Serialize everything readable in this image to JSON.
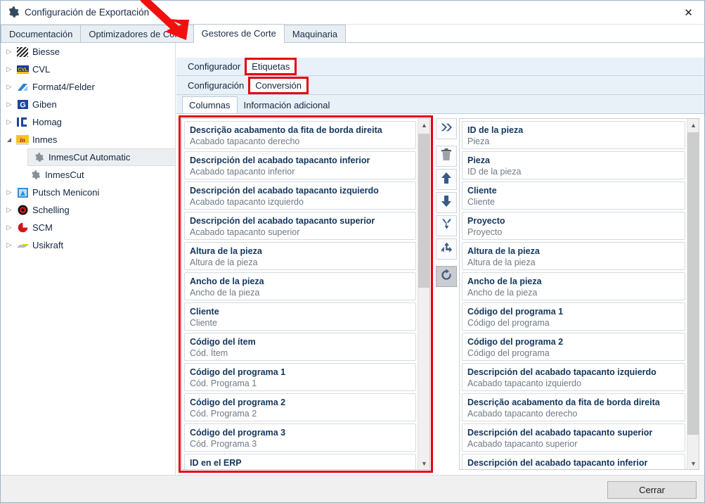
{
  "window": {
    "title": "Configuración de Exportación",
    "icon": "gear-icon",
    "close_label": "✕",
    "accent_red": "#e3000f",
    "title_color": "#12365e"
  },
  "top_tabs": [
    {
      "label": "Documentación",
      "active": false
    },
    {
      "label": "Optimizadores de Corte",
      "active": false
    },
    {
      "label": "Gestores de Corte",
      "active": true
    },
    {
      "label": "Maquinaria",
      "active": false
    }
  ],
  "sidebar": {
    "items": [
      {
        "label": "Biesse",
        "icon": "biesse-icon",
        "state": "collapsed",
        "level": 0
      },
      {
        "label": "CVL",
        "icon": "cvl-icon",
        "state": "collapsed",
        "level": 0
      },
      {
        "label": "Format4/Felder",
        "icon": "format4-icon",
        "state": "collapsed",
        "level": 0
      },
      {
        "label": "Giben",
        "icon": "giben-icon",
        "state": "collapsed",
        "level": 0
      },
      {
        "label": "Homag",
        "icon": "homag-icon",
        "state": "collapsed",
        "level": 0
      },
      {
        "label": "Inmes",
        "icon": "inmes-icon",
        "state": "expanded",
        "level": 0
      },
      {
        "label": "InmesCut Automatic",
        "icon": "gear-icon",
        "state": "selected",
        "level": 1
      },
      {
        "label": "InmesCut",
        "icon": "gear-icon",
        "state": "leaf",
        "level": 1
      },
      {
        "label": "Putsch Meniconi",
        "icon": "putsch-icon",
        "state": "collapsed",
        "level": 0
      },
      {
        "label": "Schelling",
        "icon": "schelling-icon",
        "state": "collapsed",
        "level": 0
      },
      {
        "label": "SCM",
        "icon": "scm-icon",
        "state": "collapsed",
        "level": 0
      },
      {
        "label": "Usikraft",
        "icon": "usikraft-icon",
        "state": "collapsed",
        "level": 0
      }
    ]
  },
  "level2_tabs": [
    {
      "label": "Configurador",
      "active": false,
      "highlighted": false
    },
    {
      "label": "Etiquetas",
      "active": true,
      "highlighted": true
    }
  ],
  "level3_tabs": [
    {
      "label": "Configuración",
      "active": false,
      "highlighted": false
    },
    {
      "label": "Conversión",
      "active": true,
      "highlighted": true
    }
  ],
  "level4_tabs": [
    {
      "label": "Columnas",
      "active": true
    },
    {
      "label": "Información adicional",
      "active": false
    }
  ],
  "available_list": {
    "highlighted": true,
    "scroll": {
      "thumb_top_pct": 4,
      "thumb_height_pct": 44
    },
    "items": [
      {
        "title": "Descrição acabamento da fita de borda direita",
        "sub": "Acabado tapacanto derecho"
      },
      {
        "title": "Descripción del acabado tapacanto inferior",
        "sub": "Acabado tapacanto inferior"
      },
      {
        "title": "Descripción del acabado tapacanto izquierdo",
        "sub": "Acabado tapacanto izquierdo"
      },
      {
        "title": "Descripción del acabado tapacanto superior",
        "sub": "Acabado tapacanto superior"
      },
      {
        "title": "Altura de la pieza",
        "sub": "Altura de la pieza"
      },
      {
        "title": "Ancho de la pieza",
        "sub": "Ancho de la pieza"
      },
      {
        "title": "Cliente",
        "sub": "Cliente"
      },
      {
        "title": "Código del ítem",
        "sub": "Cód. Ítem"
      },
      {
        "title": "Código del programa 1",
        "sub": "Cód. Programa 1"
      },
      {
        "title": "Código del programa 2",
        "sub": "Cód. Programa 2"
      },
      {
        "title": "Código del programa 3",
        "sub": "Cód. Programa 3"
      },
      {
        "title": "ID en el ERP",
        "sub": ""
      }
    ]
  },
  "selected_list": {
    "scroll": {
      "thumb_top_pct": 4,
      "thumb_height_pct": 86
    },
    "items": [
      {
        "title": "ID de la pieza",
        "sub": "Pieza"
      },
      {
        "title": "Pieza",
        "sub": "ID de la pieza"
      },
      {
        "title": "Cliente",
        "sub": "Cliente"
      },
      {
        "title": "Proyecto",
        "sub": "Proyecto"
      },
      {
        "title": "Altura de la pieza",
        "sub": "Altura de la pieza"
      },
      {
        "title": "Ancho de la pieza",
        "sub": "Ancho de la pieza"
      },
      {
        "title": "Código del programa 1",
        "sub": "Código del programa"
      },
      {
        "title": "Código del programa 2",
        "sub": "Código del programa"
      },
      {
        "title": "Descripción del acabado tapacanto izquierdo",
        "sub": "Acabado tapacanto izquierdo"
      },
      {
        "title": "Descrição acabamento da fita de borda direita",
        "sub": "Acabado tapacanto derecho"
      },
      {
        "title": "Descripción del acabado tapacanto superior",
        "sub": "Acabado tapacanto superior"
      },
      {
        "title": "Descripción del acabado tapacanto inferior",
        "sub": ""
      }
    ]
  },
  "transfer_buttons": [
    {
      "name": "move-all-right-button",
      "icon": "double-chevron-right-icon",
      "pressed": false
    },
    {
      "name": "delete-button",
      "icon": "trash-icon",
      "pressed": false
    },
    {
      "name": "move-up-button",
      "icon": "arrow-up-icon",
      "pressed": false
    },
    {
      "name": "move-down-button",
      "icon": "arrow-down-icon",
      "pressed": false
    },
    {
      "name": "merge-button",
      "icon": "merge-arrows-icon",
      "pressed": false
    },
    {
      "name": "split-button",
      "icon": "split-arrows-icon",
      "pressed": false
    },
    {
      "name": "reset-button",
      "icon": "refresh-icon",
      "pressed": true
    }
  ],
  "footer": {
    "close_button": "Cerrar"
  },
  "annotations": {
    "arrow_color": "#f01010",
    "arrow_target": "Gestores de Corte"
  }
}
